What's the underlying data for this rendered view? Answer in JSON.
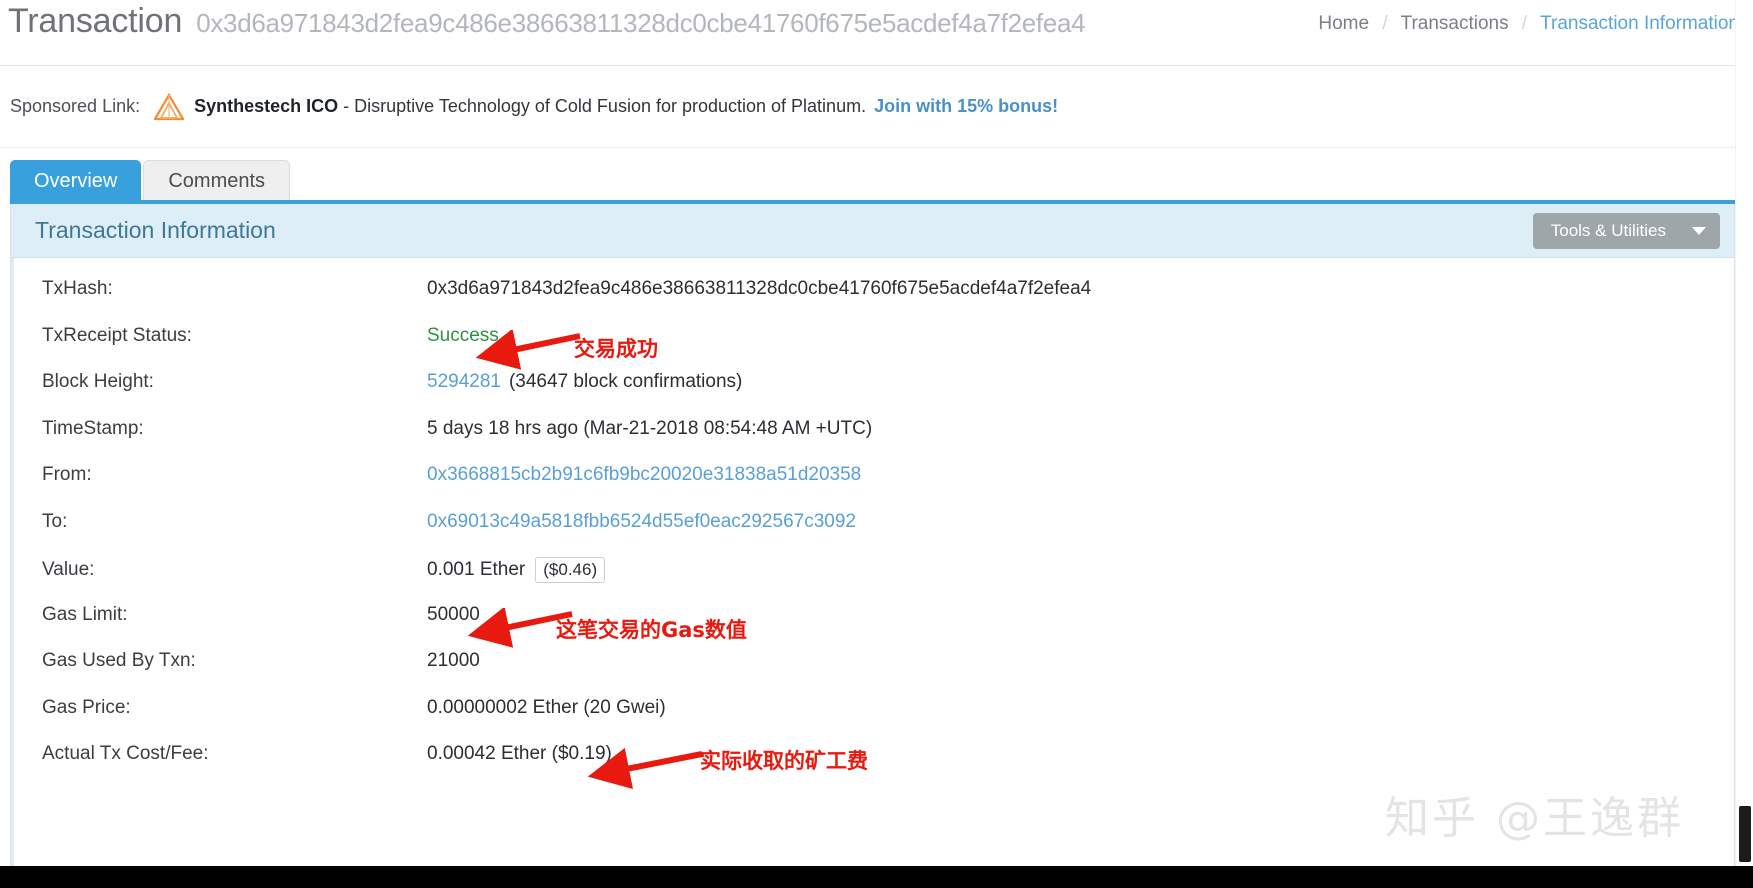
{
  "header": {
    "title": "Transaction",
    "hash": "0x3d6a971843d2fea9c486e38663811328dc0cbe41760f675e5acdef4a7f2efea4",
    "breadcrumb": {
      "home": "Home",
      "transactions": "Transactions",
      "current": "Transaction Information",
      "separator": "/"
    }
  },
  "sponsored": {
    "label": "Sponsored Link:",
    "brand": "Synthestech ICO",
    "text": "- Disruptive Technology of Cold Fusion for production of Platinum.",
    "cta": "Join with 15% bonus!",
    "logo_icon": "triangle-logo-icon",
    "brand_color": "#f08a33",
    "cta_color": "#4a90c8"
  },
  "tabs": [
    {
      "label": "Overview",
      "active": true
    },
    {
      "label": "Comments",
      "active": false
    }
  ],
  "panel": {
    "title": "Transaction Information",
    "tools_button": "Tools & Utilities",
    "tools_caret_icon": "chevron-down-icon",
    "accent_color": "#38a0dd",
    "head_bg": "#ddeef7"
  },
  "rows": [
    {
      "label": "TxHash:",
      "value": "0x3d6a971843d2fea9c486e38663811328dc0cbe41760f675e5acdef4a7f2efea4",
      "style": "plain"
    },
    {
      "label": "TxReceipt Status:",
      "value": "Success",
      "style": "success"
    },
    {
      "label": "Block Height:",
      "value": "5294281",
      "suffix": "(34647 block confirmations)",
      "style": "link"
    },
    {
      "label": "TimeStamp:",
      "value": "5 days 18 hrs ago (Mar-21-2018 08:54:48 AM +UTC)",
      "style": "plain"
    },
    {
      "label": "From:",
      "value": "0x3668815cb2b91c6fb9bc20020e31838a51d20358",
      "style": "link"
    },
    {
      "label": "To:",
      "value": "0x69013c49a5818fbb6524d55ef0eac292567c3092",
      "style": "link"
    },
    {
      "label": "Value:",
      "value": "0.001 Ether",
      "chip": "($0.46)",
      "style": "plain"
    },
    {
      "label": "Gas Limit:",
      "value": "50000",
      "style": "plain"
    },
    {
      "label": "Gas Used By Txn:",
      "value": "21000",
      "style": "plain"
    },
    {
      "label": "Gas Price:",
      "value": "0.00000002 Ether (20 Gwei)",
      "style": "plain"
    },
    {
      "label": "Actual Tx Cost/Fee:",
      "value": "0.00042 Ether ($0.19)",
      "style": "plain"
    }
  ],
  "annotations": [
    {
      "text": "交易成功",
      "color": "#e8190f"
    },
    {
      "text": "这笔交易的Gas数值",
      "color": "#e8190f"
    },
    {
      "text": "实际收取的矿工费",
      "color": "#e8190f"
    }
  ],
  "watermark": "知乎 @王逸群"
}
